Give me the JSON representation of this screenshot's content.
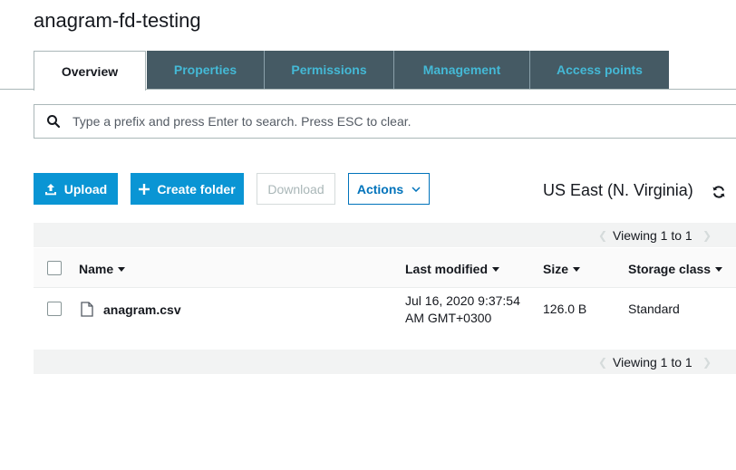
{
  "bucket": {
    "title": "anagram-fd-testing"
  },
  "tabs": [
    {
      "label": "Overview",
      "active": true
    },
    {
      "label": "Properties",
      "active": false
    },
    {
      "label": "Permissions",
      "active": false
    },
    {
      "label": "Management",
      "active": false
    },
    {
      "label": "Access points",
      "active": false
    }
  ],
  "search": {
    "placeholder": "Type a prefix and press Enter to search. Press ESC to clear."
  },
  "toolbar": {
    "upload": "Upload",
    "create_folder": "Create folder",
    "download": "Download",
    "actions": "Actions"
  },
  "region": "US East (N. Virginia)",
  "pagination": {
    "top": "Viewing 1 to 1",
    "bottom": "Viewing 1 to 1",
    "prev_icon": "chevron-left-icon",
    "next_icon": "chevron-right-icon"
  },
  "table": {
    "columns": [
      "Name",
      "Last modified",
      "Size",
      "Storage class"
    ],
    "rows": [
      {
        "name": "anagram.csv",
        "last_modified_line1": "Jul 16, 2020 9:37:54",
        "last_modified_line2": "AM GMT+0300",
        "size": "126.0 B",
        "storage_class": "Standard"
      }
    ]
  },
  "colors": {
    "primary": "#0a95d4",
    "tab_bg": "#455a64",
    "tab_text": "#44b9d6",
    "link": "#0073bb"
  }
}
